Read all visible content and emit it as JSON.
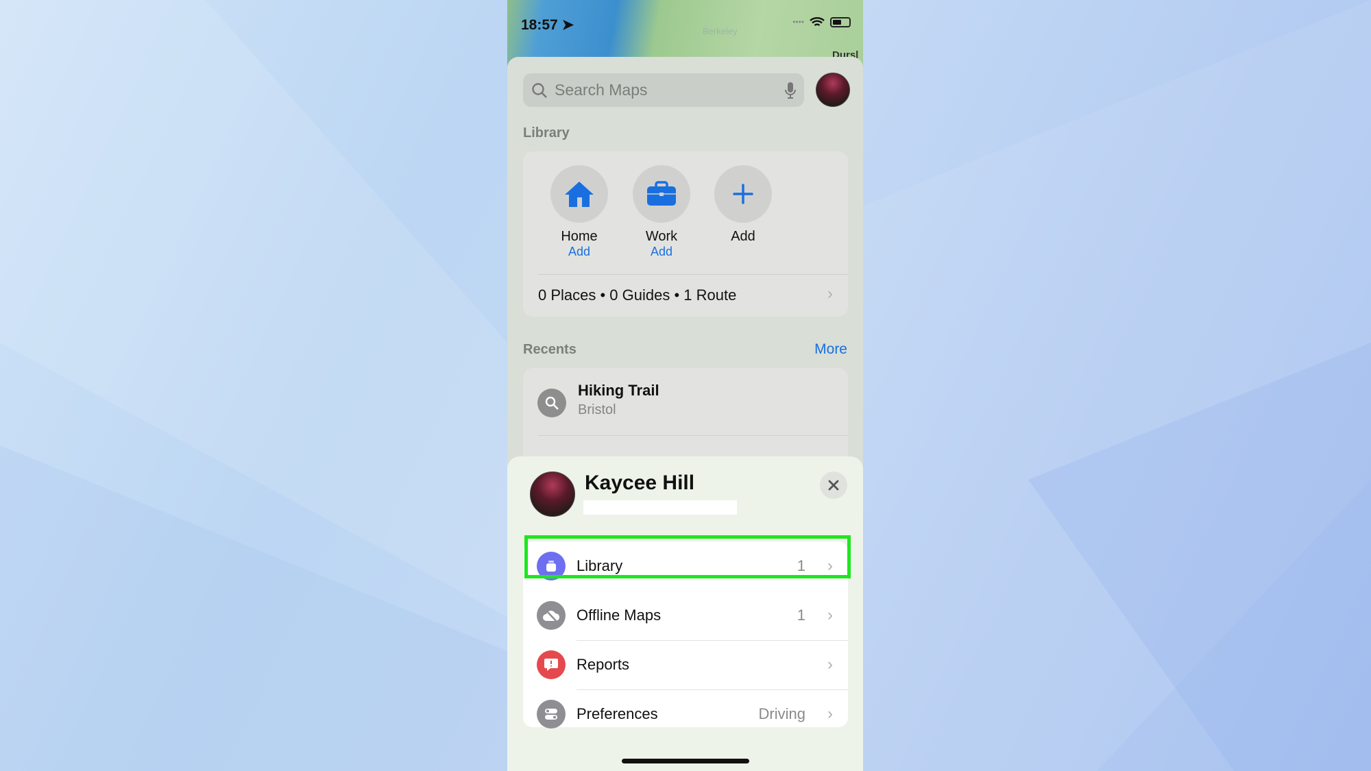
{
  "status": {
    "time": "18:57",
    "location_icon": "location-arrow-icon",
    "wifi_icon": "wifi-icon",
    "battery_icon": "battery-icon"
  },
  "map": {
    "labels": [
      "Berkeley",
      "Dursl"
    ]
  },
  "search": {
    "placeholder": "Search Maps",
    "mic_icon": "microphone-icon"
  },
  "library": {
    "title": "Library",
    "items": [
      {
        "label": "Home",
        "sub": "Add",
        "icon": "house-icon"
      },
      {
        "label": "Work",
        "sub": "Add",
        "icon": "briefcase-icon"
      },
      {
        "label": "Add",
        "icon": "plus-icon"
      }
    ],
    "summary": "0 Places • 0 Guides • 1 Route"
  },
  "recents": {
    "title": "Recents",
    "more": "More",
    "items": [
      {
        "title": "Hiking Trail",
        "subtitle": "Bristol"
      }
    ]
  },
  "profile": {
    "name": "Kaycee Hill",
    "menu": [
      {
        "label": "Library",
        "value": "1",
        "color": "#6e6ef0",
        "highlighted": true
      },
      {
        "label": "Offline Maps",
        "value": "1",
        "color": "#8e8e93"
      },
      {
        "label": "Reports",
        "value": "",
        "color": "#e5484d"
      },
      {
        "label": "Preferences",
        "value": "Driving",
        "color": "#8e8e93"
      }
    ]
  },
  "colors": {
    "accent": "#1a6fe0",
    "highlight": "#1ee61e"
  }
}
